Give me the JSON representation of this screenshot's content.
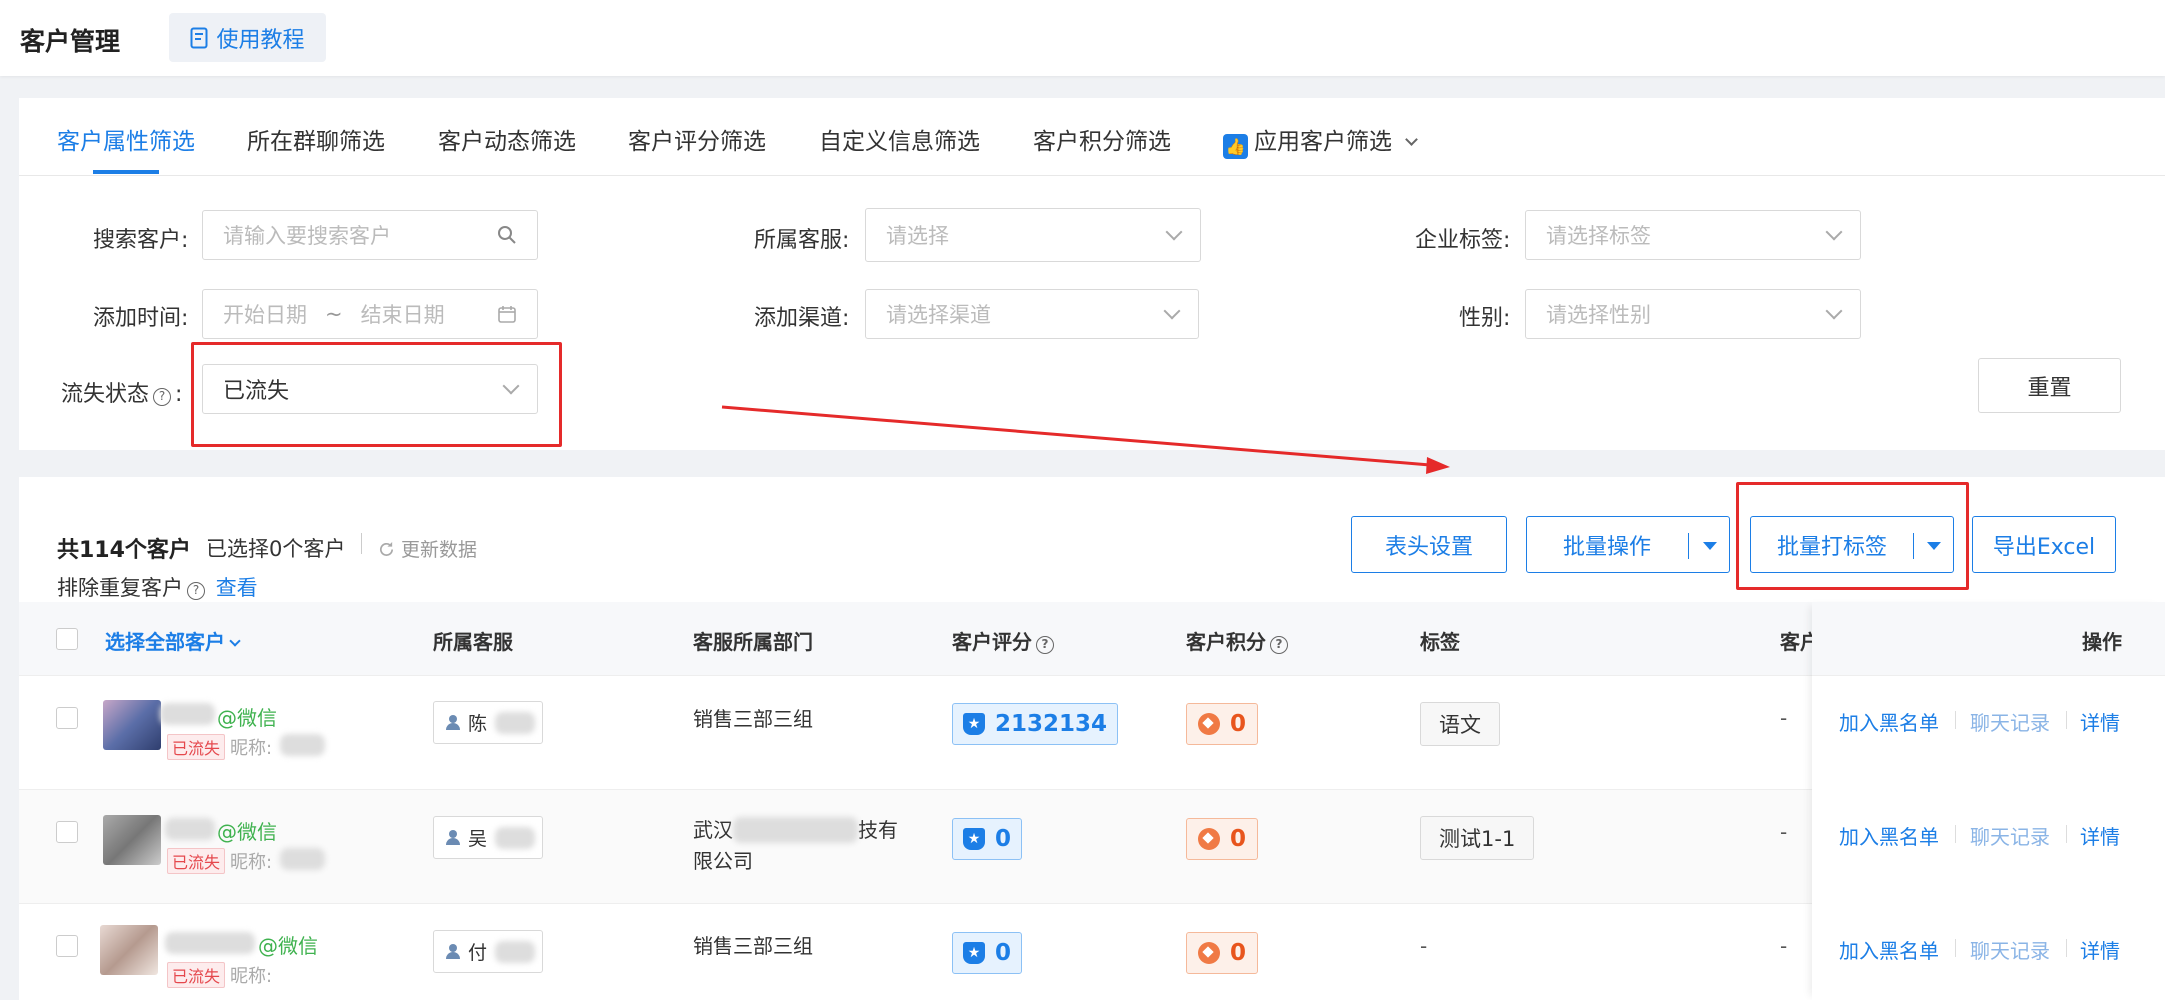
{
  "header": {
    "title": "客户管理",
    "tutorial_label": "使用教程",
    "tutorial_icon": "book-icon"
  },
  "tabs": [
    {
      "label": "客户属性筛选",
      "active": true
    },
    {
      "label": "所在群聊筛选"
    },
    {
      "label": "客户动态筛选"
    },
    {
      "label": "客户评分筛选"
    },
    {
      "label": "自定义信息筛选"
    },
    {
      "label": "客户积分筛选"
    },
    {
      "label": "应用客户筛选",
      "icon": "thumbs-up-icon"
    }
  ],
  "filters": {
    "search": {
      "label": "搜索客户",
      "placeholder": "请输入要搜索客户"
    },
    "agent": {
      "label": "所属客服",
      "placeholder": "请选择"
    },
    "corp_tag": {
      "label": "企业标签",
      "placeholder": "请选择标签"
    },
    "add_time": {
      "label": "添加时间",
      "start": "开始日期",
      "sep": "~",
      "end": "结束日期"
    },
    "channel": {
      "label": "添加渠道",
      "placeholder": "请选择渠道"
    },
    "gender": {
      "label": "性别",
      "placeholder": "请选择性别"
    },
    "churn": {
      "label": "流失状态",
      "value": "已流失"
    },
    "reset_label": "重置"
  },
  "list": {
    "total": "共114个客户",
    "selected": "已选择0个客户",
    "refresh": "更新数据",
    "dedup": "排除重复客户",
    "dedup_link": "查看",
    "buttons": {
      "columns": "表头设置",
      "batch": "批量操作",
      "batch_tag": "批量打标签",
      "export": "导出Excel"
    }
  },
  "table": {
    "headers": {
      "select_all": "选择全部客户",
      "agent": "所属客服",
      "dept": "客服所属部门",
      "score": "客户评分",
      "points": "客户积分",
      "tags": "标签",
      "customer": "客户",
      "ops": "操作"
    },
    "rows": [
      {
        "wechat": "@微信",
        "lost": "已流失",
        "nick": "昵称:",
        "agent": "陈",
        "dept_line1": "销售三部三组",
        "dept_line2": "",
        "score": "2132134",
        "points": "0",
        "tag": "语文",
        "customer": "-"
      },
      {
        "wechat": "@微信",
        "lost": "已流失",
        "nick": "昵称:",
        "agent": "吴",
        "dept_line1": "武汉",
        "dept_mid": "技有",
        "dept_line2": "限公司",
        "score": "0",
        "points": "0",
        "tag": "测试1-1",
        "customer": "-"
      },
      {
        "wechat": "@微信",
        "lost": "已流失",
        "nick": "昵称:",
        "agent": "付",
        "dept_line1": "销售三部三组",
        "dept_line2": "",
        "score": "0",
        "points": "0",
        "tag": "-",
        "customer": "-"
      }
    ],
    "ops": {
      "blacklist": "加入黑名单",
      "chat": "聊天记录",
      "detail": "详情"
    }
  },
  "colors": {
    "accent": "#1c7ee6",
    "annotation": "#e52a2a",
    "lost": "#e5484d",
    "wechat": "#3fb24f"
  }
}
